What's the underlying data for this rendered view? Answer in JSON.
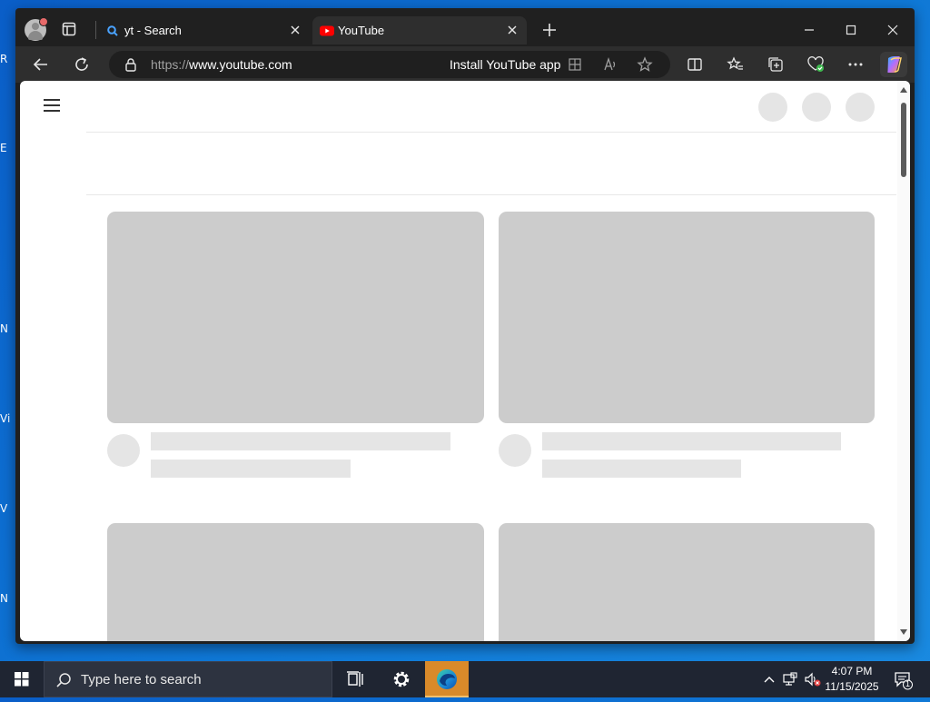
{
  "desktop": {
    "fragments": [
      "R",
      "E",
      "N",
      "Vi",
      "V",
      "N"
    ]
  },
  "browser": {
    "tabs": [
      {
        "title": "yt - Search",
        "icon": "bing-search-icon"
      },
      {
        "title": "YouTube",
        "icon": "youtube-icon",
        "active": true
      }
    ],
    "address": {
      "scheme": "https://",
      "host": "www.youtube.com"
    },
    "install_label": "Install YouTube app",
    "accent_youtube": "#ff0000"
  },
  "taskbar": {
    "search_placeholder": "Type here to search",
    "time": "4:07 PM",
    "date": "11/15/2025",
    "notification_count": "1"
  }
}
